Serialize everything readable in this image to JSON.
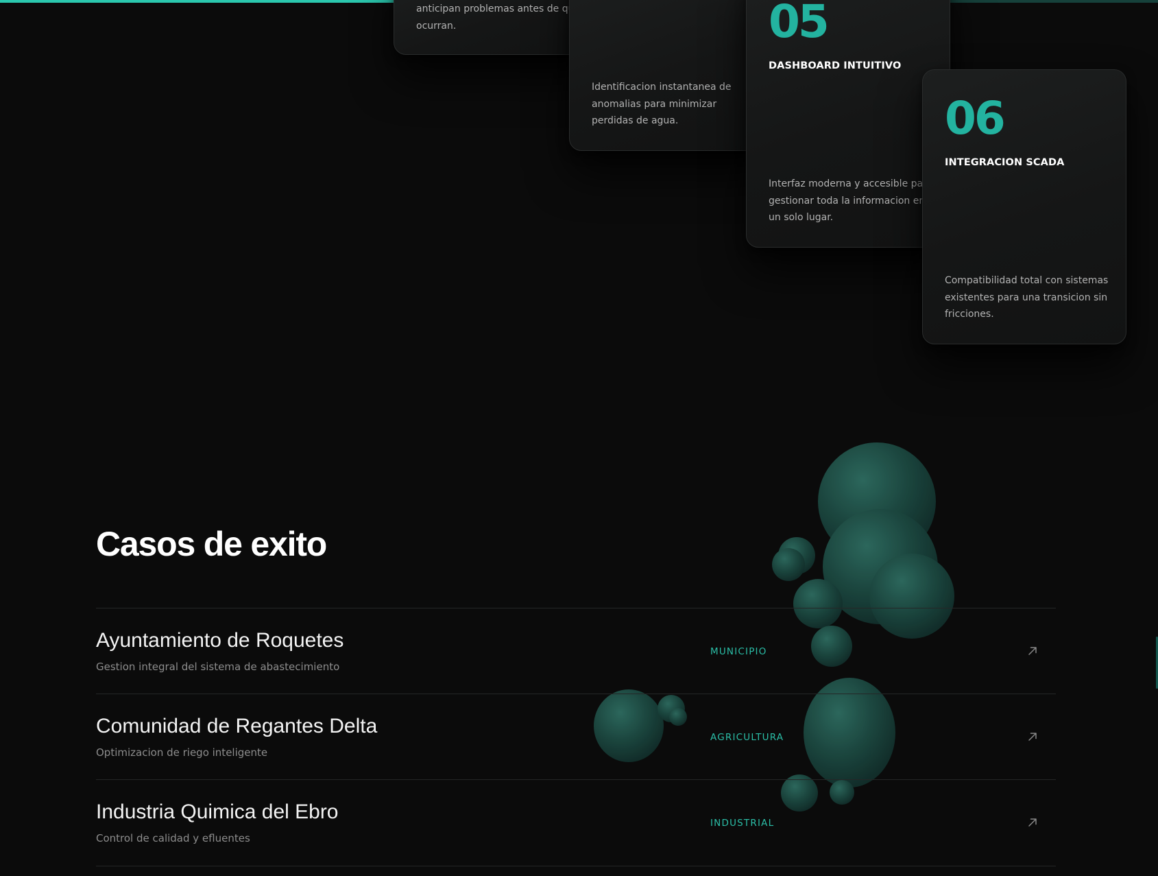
{
  "progress": {
    "fraction": 0.773
  },
  "colors": {
    "background": "#0b0b0b",
    "accent": "#23b3a0",
    "tag": "#2bbfa8",
    "bubble": "#1c4a43"
  },
  "features": {
    "card_04": {
      "description_lines": [
        "anticipan problemas antes de que",
        "ocurran."
      ]
    },
    "card_anomalies": {
      "description_lines": [
        "Identificacion instantanea de",
        "anomalias para minimizar",
        "perdidas de agua."
      ]
    },
    "card_05": {
      "number": "05",
      "title": "DASHBOARD INTUITIVO",
      "description_lines": [
        "Interfaz moderna y accesible para",
        "gestionar toda la informacion en",
        "un solo lugar."
      ]
    },
    "card_06": {
      "number": "06",
      "title": "INTEGRACION SCADA",
      "description_lines": [
        "Compatibilidad total con sistemas",
        "existentes para una transicion sin",
        "fricciones."
      ]
    }
  },
  "cases": {
    "title": "Casos de exito",
    "items": [
      {
        "name": "Ayuntamiento de Roquetes",
        "description": "Gestion integral del sistema de abastecimiento",
        "tag": "MUNICIPIO",
        "icon": "arrow-up-right-icon"
      },
      {
        "name": "Comunidad de Regantes Delta",
        "description": "Optimizacion de riego inteligente",
        "tag": "AGRICULTURA",
        "icon": "arrow-up-right-icon"
      },
      {
        "name": "Industria Quimica del Ebro",
        "description": "Control de calidad y efluentes",
        "tag": "INDUSTRIAL",
        "icon": "arrow-up-right-icon"
      }
    ]
  }
}
